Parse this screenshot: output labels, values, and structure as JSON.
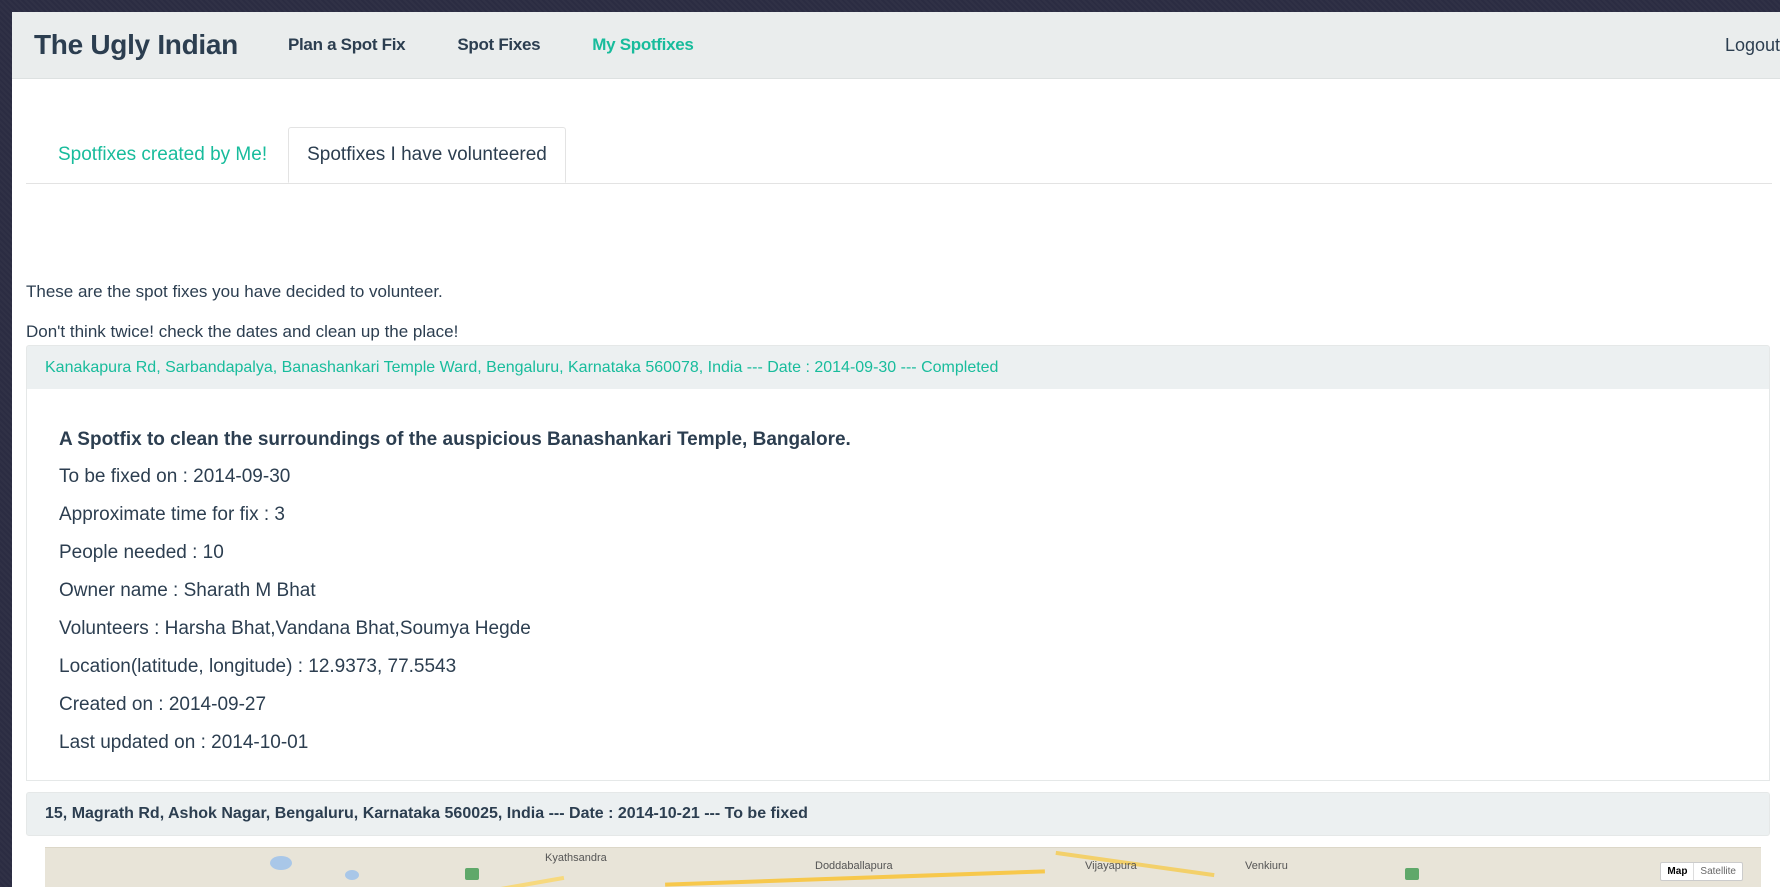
{
  "navbar": {
    "brand": "The Ugly Indian",
    "links": [
      "Plan a Spot Fix",
      "Spot Fixes",
      "My Spotfixes"
    ],
    "logout": "Logout"
  },
  "tabs": {
    "created": "Spotfixes created by Me!",
    "volunteered": "Spotfixes I have volunteered"
  },
  "intro": {
    "line1": "These are the spot fixes you have decided to volunteer.",
    "line2": "Don't think twice! check the dates and clean up the place!"
  },
  "spotfixes": [
    {
      "heading": "Kanakapura Rd, Sarbandapalya, Banashankari Temple Ward, Bengaluru, Karnataka 560078, India --- Date : 2014-09-30 --- Completed",
      "title": "A Spotfix to clean the surroundings of the auspicious Banashankari Temple, Bangalore.",
      "to_be_fixed": "To be fixed on : 2014-09-30",
      "approx_time": "Approximate time for fix : 3",
      "people_needed": "People needed : 10",
      "owner": "Owner name : Sharath M Bhat",
      "volunteers": "Volunteers : Harsha Bhat,Vandana Bhat,Soumya Hegde",
      "location": "Location(latitude, longitude) : 12.9373, 77.5543",
      "created_on": "Created on : 2014-09-27",
      "last_updated": "Last updated on : 2014-10-01"
    },
    {
      "heading": "15, Magrath Rd, Ashok Nagar, Bengaluru, Karnataka 560025, India --- Date : 2014-10-21 --- To be fixed"
    }
  ],
  "map": {
    "labels": [
      "Kyathsandra",
      "Doddaballapura",
      "Vijayapura",
      "Venkiuru"
    ],
    "toggle_map": "Map",
    "toggle_satellite": "Satellite"
  }
}
